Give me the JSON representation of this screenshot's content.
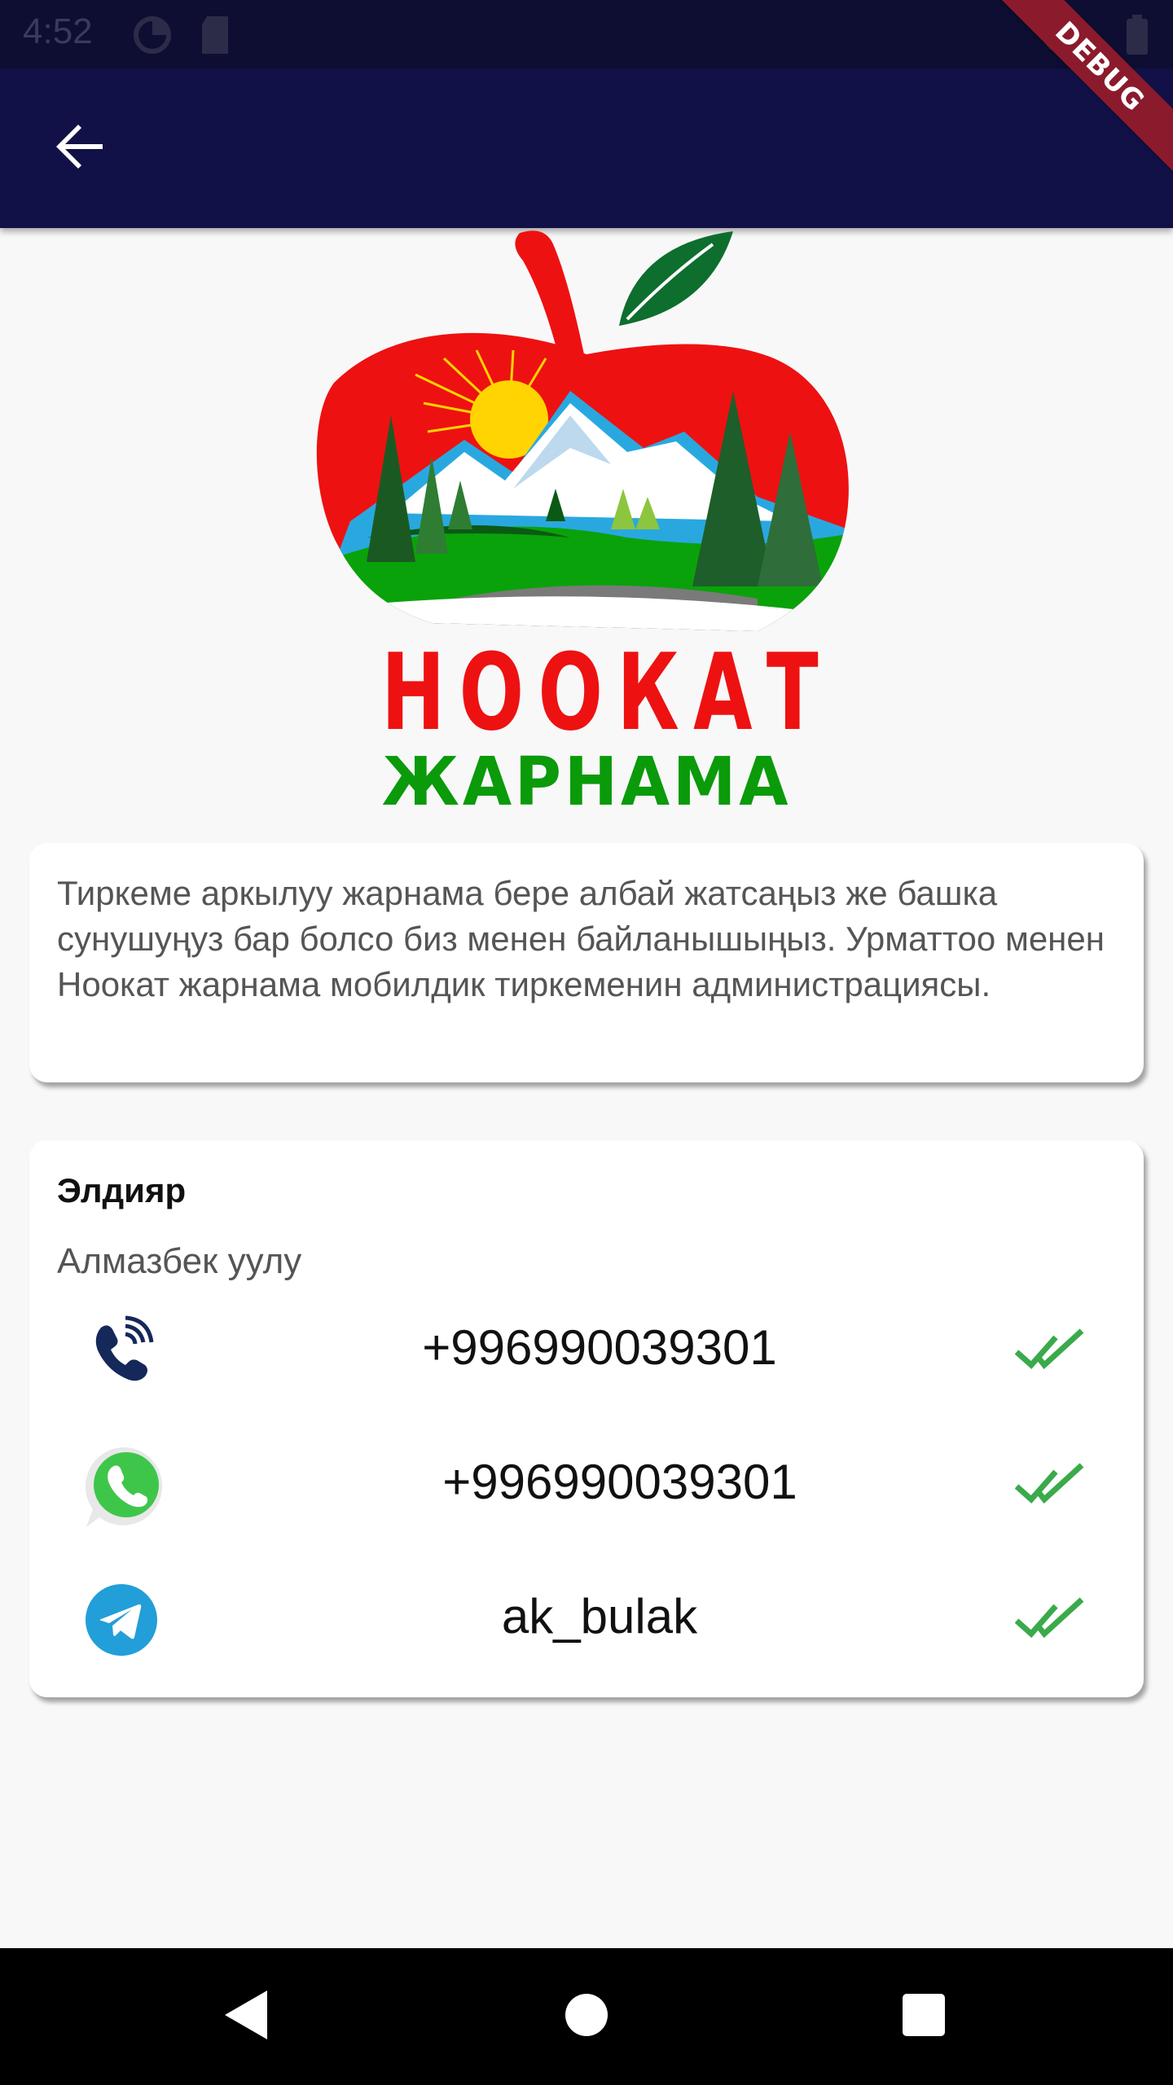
{
  "status_bar": {
    "time": "4:52",
    "icons": [
      "data-saver-icon",
      "sd-card-icon",
      "wifi-icon",
      "battery-icon"
    ]
  },
  "app_bar": {
    "back_icon": "arrow-back-icon",
    "debug_label": "DEBUG"
  },
  "logo": {
    "title": "НООКАТ",
    "subtitle": "ЖАРНАМА",
    "colors": {
      "red": "#ee1111",
      "green": "#0a9a0a",
      "leaf": "#0d6e2e"
    }
  },
  "info_card": {
    "text": "Тиркеме аркылуу жарнама бере албай жатсаңыз же башка сунушуңуз бар болсо биз менен байланышыңыз. Урматтоо менен Ноокат жарнама мобилдик тиркеменин администрациясы."
  },
  "contact": {
    "name": "Элдияр",
    "surname": "Алмазбек уулу",
    "rows": [
      {
        "icon": "viber-phone-icon",
        "value": "+996990039301"
      },
      {
        "icon": "whatsapp-icon",
        "value": "+996990039301"
      },
      {
        "icon": "telegram-icon",
        "value": "ak_bulak"
      }
    ]
  },
  "nav_bar": {
    "buttons": [
      "back-triangle-icon",
      "home-circle-icon",
      "recents-square-icon"
    ]
  },
  "colors": {
    "app_bar": "#111148",
    "check": "#3aaa4a",
    "whatsapp": "#3ec64b",
    "telegram": "#229ed9",
    "viber_phone": "#15285a"
  }
}
